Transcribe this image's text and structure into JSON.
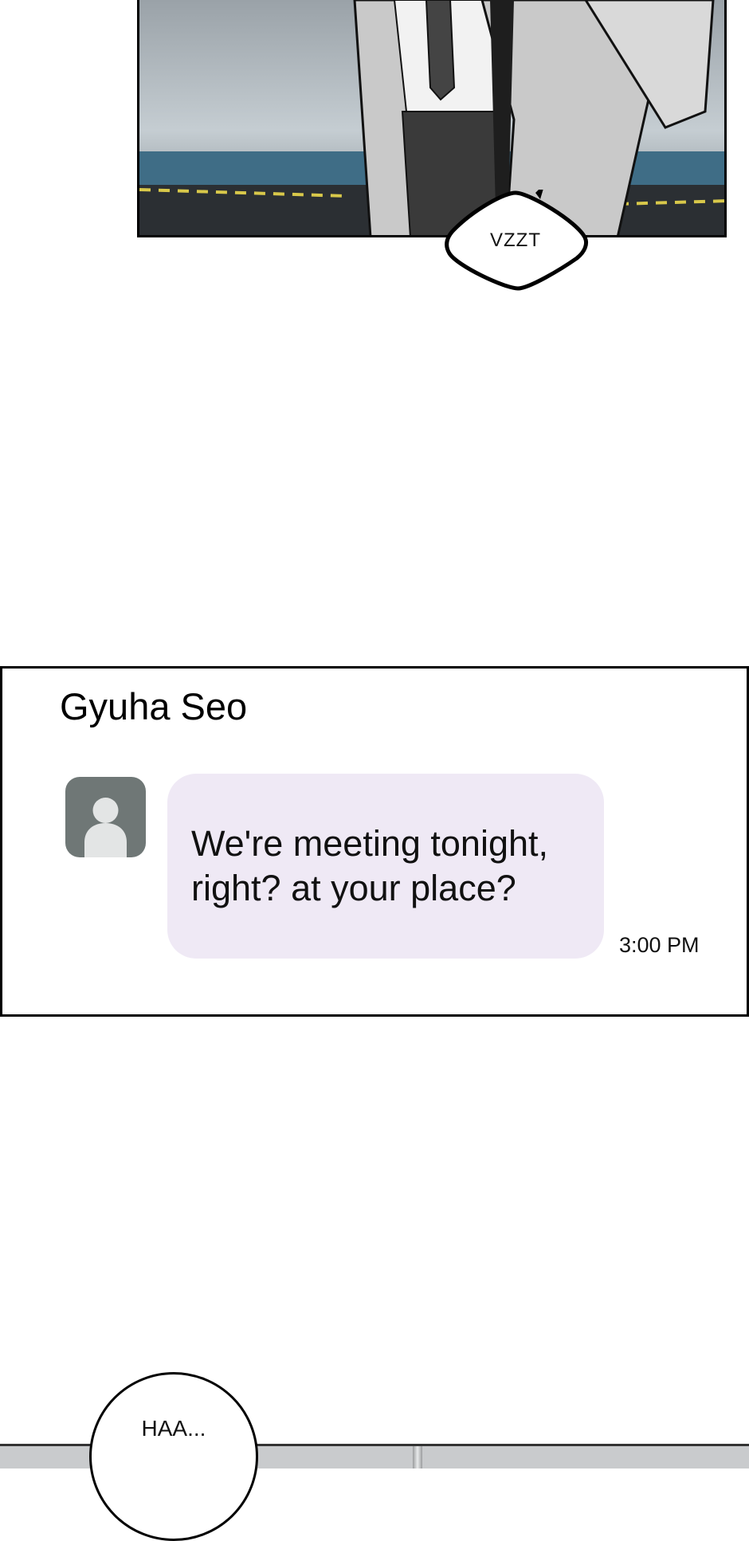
{
  "top_panel": {
    "sfx_text": "VZZT"
  },
  "chat": {
    "contact_name": "Gyuha Seo",
    "avatar_icon": "person-silhouette-icon",
    "message": "We're meeting tonight,\nright? at your place?",
    "timestamp": "3:00 PM",
    "colors": {
      "bubble": "#efe9f5",
      "avatar_bg": "#6f7776"
    }
  },
  "bottom_panel": {
    "speech_text": "HAA..."
  }
}
